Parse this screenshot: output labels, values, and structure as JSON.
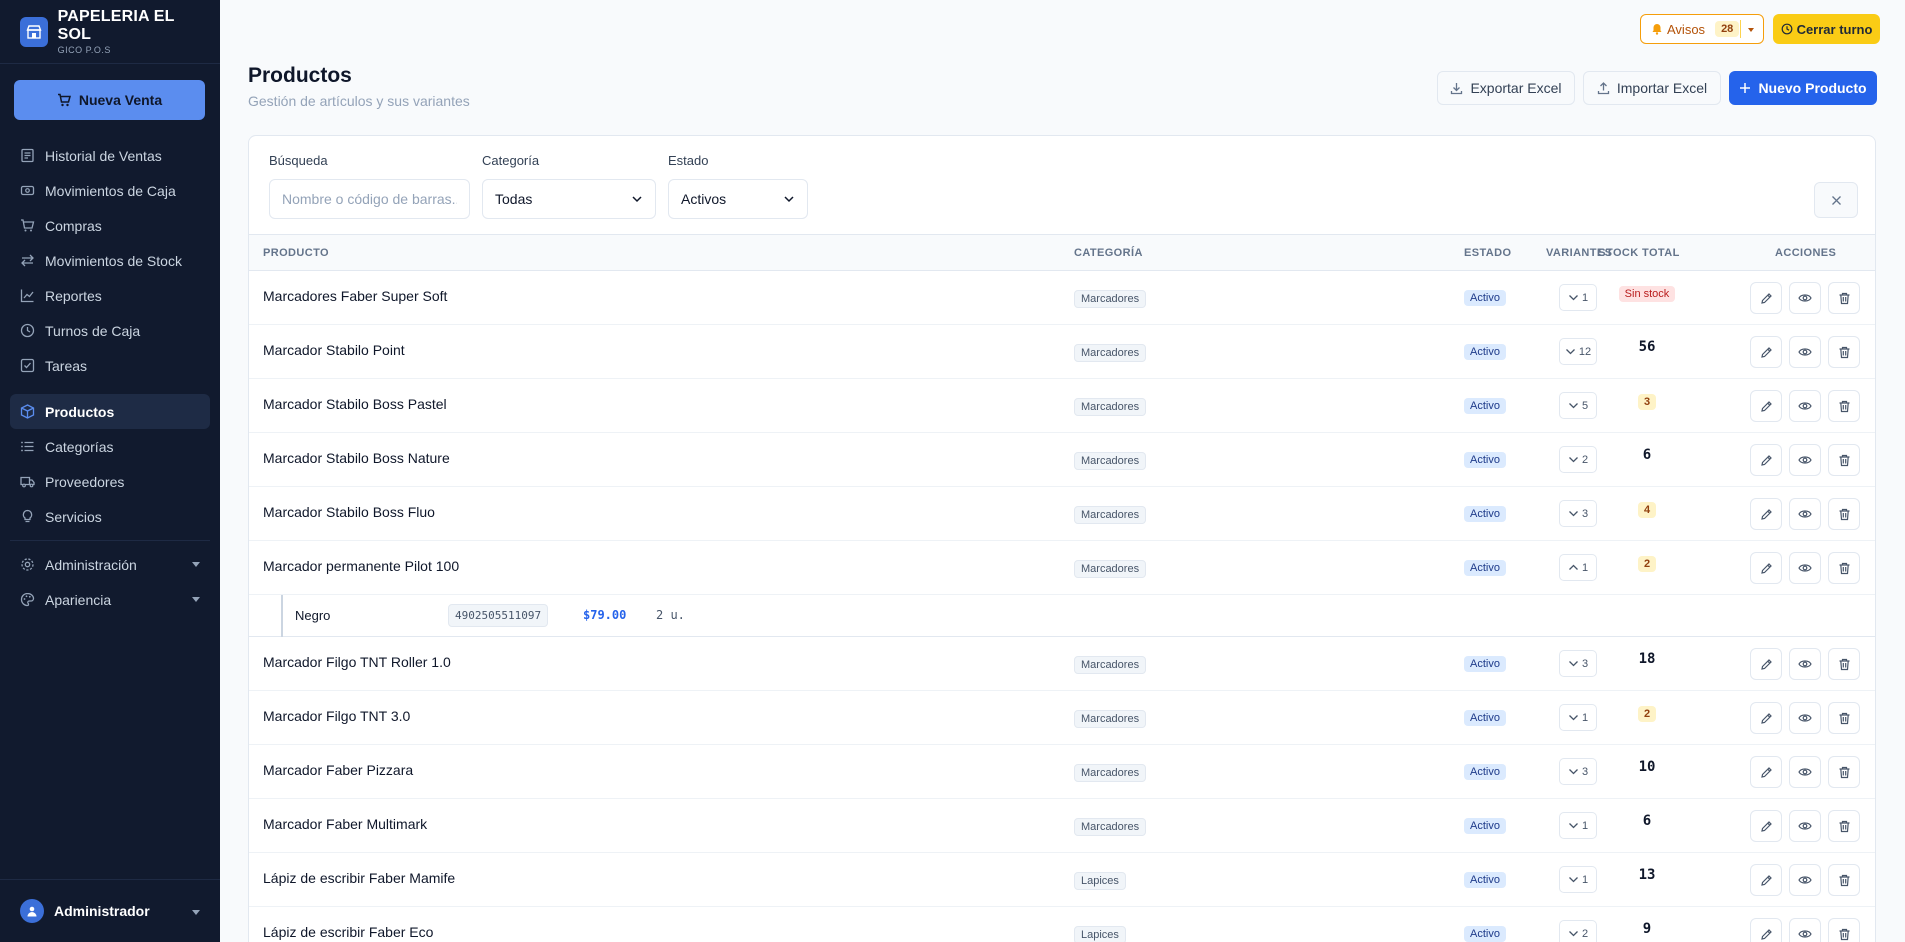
{
  "brand": {
    "title": "PAPELERIA EL SOL",
    "subtitle": "GICO P.O.S"
  },
  "sidebar": {
    "new_sale": "Nueva Venta",
    "items": [
      {
        "label": "Historial de Ventas",
        "icon": "receipt-icon"
      },
      {
        "label": "Movimientos de Caja",
        "icon": "cash-icon"
      },
      {
        "label": "Compras",
        "icon": "cart-icon"
      },
      {
        "label": "Movimientos de Stock",
        "icon": "arrows-icon"
      },
      {
        "label": "Reportes",
        "icon": "chart-icon"
      },
      {
        "label": "Turnos de Caja",
        "icon": "clock-icon"
      },
      {
        "label": "Tareas",
        "icon": "checklist-icon"
      },
      {
        "label": "Productos",
        "icon": "box-icon",
        "active": true
      },
      {
        "label": "Categorías",
        "icon": "list-icon"
      },
      {
        "label": "Proveedores",
        "icon": "truck-icon"
      },
      {
        "label": "Servicios",
        "icon": "bulb-icon"
      },
      {
        "label": "Administración",
        "icon": "gear-icon"
      },
      {
        "label": "Apariencia",
        "icon": "palette-icon"
      }
    ],
    "user": "Administrador"
  },
  "topbar": {
    "avisos_label": "Avisos",
    "avisos_count": "28",
    "cerrar_turno": "Cerrar turno"
  },
  "page": {
    "title": "Productos",
    "subtitle": "Gestión de artículos y sus variantes",
    "export": "Exportar Excel",
    "import": "Importar Excel",
    "new_product": "Nuevo Producto"
  },
  "filters": {
    "search_label": "Búsqueda",
    "search_placeholder": "Nombre o código de barras...",
    "category_label": "Categoría",
    "category_value": "Todas",
    "status_label": "Estado",
    "status_value": "Activos"
  },
  "table": {
    "headers": {
      "product": "PRODUCTO",
      "category": "CATEGORÍA",
      "status": "ESTADO",
      "variants": "VARIANTES",
      "stock": "STOCK TOTAL",
      "actions": "ACCIONES"
    },
    "rows": [
      {
        "name": "Marcadores Faber Super Soft",
        "category": "Marcadores",
        "status": "Activo",
        "variants": "1",
        "stock": "Sin stock",
        "stock_style": "red",
        "expanded": false
      },
      {
        "name": "Marcador Stabilo Point",
        "category": "Marcadores",
        "status": "Activo",
        "variants": "12",
        "stock": "56",
        "stock_style": "plain",
        "expanded": false
      },
      {
        "name": "Marcador Stabilo Boss Pastel",
        "category": "Marcadores",
        "status": "Activo",
        "variants": "5",
        "stock": "3",
        "stock_style": "amber",
        "expanded": false
      },
      {
        "name": "Marcador Stabilo Boss Nature",
        "category": "Marcadores",
        "status": "Activo",
        "variants": "2",
        "stock": "6",
        "stock_style": "plain",
        "expanded": false
      },
      {
        "name": "Marcador Stabilo Boss Fluo",
        "category": "Marcadores",
        "status": "Activo",
        "variants": "3",
        "stock": "4",
        "stock_style": "amber",
        "expanded": false
      },
      {
        "name": "Marcador permanente Pilot 100",
        "category": "Marcadores",
        "status": "Activo",
        "variants": "1",
        "stock": "2",
        "stock_style": "amber",
        "expanded": true,
        "variant_rows": [
          {
            "name": "Negro",
            "barcode": "4902505511097",
            "price": "$79.00",
            "qty": "2 u."
          }
        ]
      },
      {
        "name": "Marcador Filgo TNT Roller 1.0",
        "category": "Marcadores",
        "status": "Activo",
        "variants": "3",
        "stock": "18",
        "stock_style": "plain",
        "expanded": false
      },
      {
        "name": "Marcador Filgo TNT 3.0",
        "category": "Marcadores",
        "status": "Activo",
        "variants": "1",
        "stock": "2",
        "stock_style": "amber",
        "expanded": false
      },
      {
        "name": "Marcador Faber Pizzara",
        "category": "Marcadores",
        "status": "Activo",
        "variants": "3",
        "stock": "10",
        "stock_style": "plain",
        "expanded": false
      },
      {
        "name": "Marcador Faber Multimark",
        "category": "Marcadores",
        "status": "Activo",
        "variants": "1",
        "stock": "6",
        "stock_style": "plain",
        "expanded": false
      },
      {
        "name": "Lápiz de escribir Faber Mamife",
        "category": "Lapices",
        "status": "Activo",
        "variants": "1",
        "stock": "13",
        "stock_style": "plain",
        "expanded": false
      },
      {
        "name": "Lápiz de escribir Faber Eco",
        "category": "Lapices",
        "status": "Activo",
        "variants": "2",
        "stock": "9",
        "stock_style": "plain",
        "expanded": false
      }
    ]
  },
  "colors": {
    "sidebar_bg": "#111a2e",
    "primary": "#2563eb",
    "warning": "#facc15",
    "danger_bg": "#fee2e2"
  }
}
